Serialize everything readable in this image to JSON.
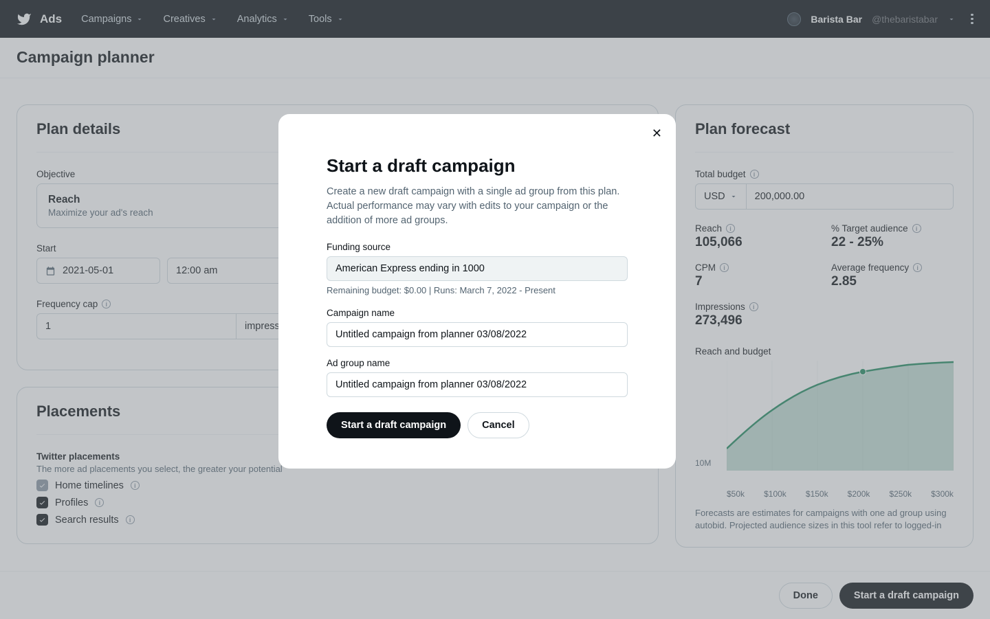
{
  "nav": {
    "brand": "Ads",
    "items": [
      "Campaigns",
      "Creatives",
      "Analytics",
      "Tools"
    ],
    "user_name": "Barista Bar",
    "user_handle": "@thebaristabar"
  },
  "page_title": "Campaign planner",
  "plan_details": {
    "title": "Plan details",
    "objective_label": "Objective",
    "objective_title": "Reach",
    "objective_sub": "Maximize your ad's reach",
    "start_label": "Start",
    "start_date": "2021-05-01",
    "start_time": "12:00 am",
    "freq_label": "Frequency cap",
    "freq_value": "1",
    "freq_unit": "impression"
  },
  "placements": {
    "title": "Placements",
    "sub_label": "Twitter placements",
    "sub_desc": "The more ad placements you select, the greater your potential",
    "items": [
      {
        "label": "Home timelines",
        "state": "disabled-checked"
      },
      {
        "label": "Profiles",
        "state": "checked"
      },
      {
        "label": "Search results",
        "state": "checked"
      }
    ]
  },
  "forecast": {
    "title": "Plan forecast",
    "budget_label": "Total budget",
    "currency": "USD",
    "budget_value": "200,000.00",
    "stats": {
      "reach_label": "Reach",
      "reach_value": "105,066",
      "target_label": "% Target audience",
      "target_value": "22 - 25%",
      "cpm_label": "CPM",
      "cpm_value": "7",
      "freq_label": "Average frequency",
      "freq_value": "2.85",
      "impr_label": "Impressions",
      "impr_value": "273,496"
    },
    "chart_label": "Reach and budget",
    "note": "Forecasts are estimates for campaigns with one ad group using autobid. Projected audience sizes in this tool refer to logged-in"
  },
  "chart_data": {
    "type": "area",
    "xlabel": "Budget",
    "ylabel": "Reach",
    "x_ticks": [
      "$50k",
      "$100k",
      "$150k",
      "$200k",
      "$250k",
      "$300k"
    ],
    "y_tick": "10M",
    "marker_x": "$200k",
    "series": [
      {
        "name": "Reach",
        "x": [
          50000,
          100000,
          150000,
          200000,
          250000,
          300000
        ],
        "values_est_rel": [
          0.2,
          0.55,
          0.78,
          0.9,
          0.96,
          0.99
        ]
      }
    ],
    "xlim": [
      50000,
      300000
    ]
  },
  "bottom": {
    "done": "Done",
    "start": "Start a draft campaign"
  },
  "modal": {
    "title": "Start a draft campaign",
    "desc": "Create a new draft campaign with a single ad group from this plan. Actual performance may vary with edits to your campaign or the addition of more ad groups.",
    "funding_label": "Funding source",
    "funding_value": "American Express ending in 1000",
    "funding_hint": "Remaining budget: $0.00 | Runs: March 7, 2022 - Present",
    "campaign_label": "Campaign name",
    "campaign_value": "Untitled campaign from planner 03/08/2022",
    "adgroup_label": "Ad group name",
    "adgroup_value": "Untitled campaign from planner 03/08/2022",
    "start_btn": "Start a draft campaign",
    "cancel_btn": "Cancel"
  }
}
